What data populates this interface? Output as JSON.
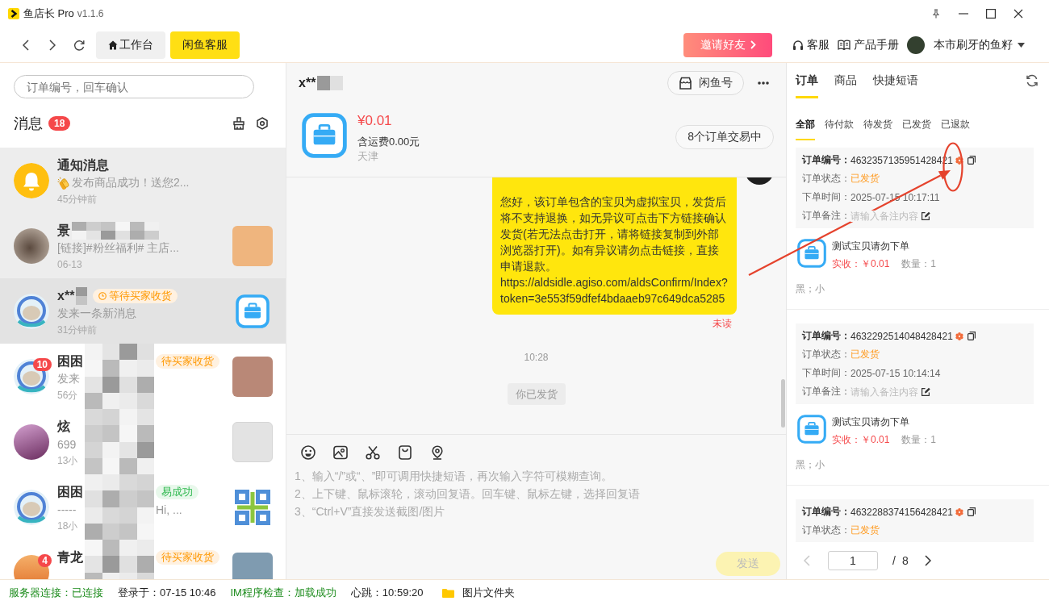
{
  "window": {
    "title": "鱼店长 Pro",
    "version": "v1.1.6"
  },
  "toolbar": {
    "tabs": [
      {
        "label": "工作台",
        "kind": "home",
        "selected": false
      },
      {
        "label": "闲鱼客服",
        "kind": "plain",
        "selected": true
      }
    ],
    "invite_button": "邀请好友",
    "links": [
      {
        "kind": "support",
        "label": "客服"
      },
      {
        "kind": "manual",
        "label": "产品手册"
      }
    ],
    "user_name": "本市刷牙的鱼籽"
  },
  "messages": {
    "search": {
      "placeholder": "订单编号，回车确认"
    },
    "title": "消息",
    "unread_total": "18",
    "conversations": [
      {
        "avatar": {
          "kind": "bell"
        },
        "name": "通知消息",
        "emoji": true,
        "preview": "发布商品成功！送您2...",
        "time": "45分钟前",
        "pinned": true,
        "selected": false
      },
      {
        "avatar": {
          "kind": "photo"
        },
        "name": "景",
        "mosaic": {
          "kind": "name"
        },
        "emoji": false,
        "preview": "[链接]#粉丝福利# 主店...",
        "time": "06-13",
        "thumbnail": {
          "kind": "photo"
        },
        "pinned": true,
        "selected": false
      },
      {
        "avatar": {
          "kind": "cartoon"
        },
        "name": "x**",
        "mosaic": {
          "kind": "name"
        },
        "tag": {
          "text": "等待买家收货",
          "kind": "pending",
          "icon": true
        },
        "emoji": false,
        "preview": "发来一条新消息",
        "time": "31分钟前",
        "thumbnail": {
          "kind": "briefcase"
        },
        "pinned": false,
        "selected": true
      },
      {
        "avatar": {
          "kind": "cartoon"
        },
        "unread": "10",
        "name": "困困",
        "mosaic": {
          "kind": "column"
        },
        "tag": {
          "text": "待买家收货",
          "kind": "pending",
          "icon": false
        },
        "emoji": false,
        "preview": "发来",
        "time": "56分",
        "thumbnail": {
          "kind": "photo"
        },
        "pinned": false,
        "selected": false
      },
      {
        "avatar": {
          "kind": "artwork"
        },
        "name": "炫",
        "mosaic": {
          "kind": "column"
        },
        "emoji": false,
        "preview": "699",
        "time": "13小",
        "thumbnail": {
          "kind": "screenshot"
        },
        "pinned": false,
        "selected": false
      },
      {
        "avatar": {
          "kind": "cartoon"
        },
        "name": "困困",
        "mosaic": {
          "kind": "column"
        },
        "tag": {
          "text": "易成功",
          "kind": "success",
          "icon": false
        },
        "emoji": false,
        "preview": "-----",
        "preview_tail": "Hi, ...",
        "time": "18小",
        "thumbnail": {
          "kind": "pattern"
        },
        "pinned": false,
        "selected": false
      },
      {
        "avatar": {
          "kind": "sunset"
        },
        "unread": "4",
        "name": "青龙",
        "mosaic": {
          "kind": "column"
        },
        "tag": {
          "text": "待买家收货",
          "kind": "pending",
          "icon": false
        },
        "emoji": false,
        "thumbnail": {
          "kind": "photo"
        },
        "pinned": false,
        "selected": false
      }
    ]
  },
  "chat": {
    "header": {
      "name": "x**",
      "redacted": true,
      "account_button": "闲鱼号"
    },
    "product": {
      "price": "¥0.01",
      "shipping": "含运费0.00元",
      "location": "天津",
      "orders_button": "8个订单交易中"
    },
    "messages": [
      {
        "kind": "bubble",
        "text": "您好，该订单包含的宝贝为虚拟宝贝，发货后将不支持退换，如无异议可点击下方链接确认发货(若无法点击打开，请将链接复制到外部浏览器打开)。如有异议请勿点击链接，直接申请退款。\nhttps://aldsidle.agiso.com/aldsConfirm/Index?token=3e553f59dfef4bdaaeb97c649dca5285",
        "status": "未读"
      },
      {
        "kind": "time",
        "text": "10:28"
      },
      {
        "kind": "system",
        "text": "你已发货"
      }
    ],
    "composer": {
      "placeholder": "1、输入“/”或“、”即可调用快捷短语，再次输入字符可模糊查询。\n2、上下键、鼠标滚轮，滚动回复语。回车键、鼠标左键，选择回复语\n3、“Ctrl+V”直接发送截图/图片",
      "send_button": "发送",
      "send_disabled": true
    }
  },
  "orders": {
    "tabs": [
      {
        "label": "订单",
        "selected": true
      },
      {
        "label": "商品",
        "selected": false
      },
      {
        "label": "快捷短语",
        "selected": false
      }
    ],
    "filters": [
      {
        "label": "全部",
        "selected": true
      },
      {
        "label": "待付款",
        "selected": false
      },
      {
        "label": "待发货",
        "selected": false
      },
      {
        "label": "已发货",
        "selected": false
      },
      {
        "label": "已退款",
        "selected": false
      }
    ],
    "list": [
      {
        "fields": [
          {
            "kind": "number",
            "label": "订单编号：",
            "value": "4632357135951428421"
          },
          {
            "kind": "status",
            "label": "订单状态：",
            "value": "已发货"
          },
          {
            "kind": "time",
            "label": "下单时间：",
            "value": "2025-07-15 10:17:11"
          },
          {
            "kind": "note",
            "label": "订单备注：",
            "placeholder": "请输入备注内容"
          }
        ],
        "item": {
          "title": "测试宝贝请勿下单",
          "paid": "实收：￥0.01",
          "quantity": "数量：1",
          "spec": "黑；小"
        }
      },
      {
        "fields": [
          {
            "kind": "number",
            "label": "订单编号：",
            "value": "4632292514048428421"
          },
          {
            "kind": "status",
            "label": "订单状态：",
            "value": "已发货"
          },
          {
            "kind": "time",
            "label": "下单时间：",
            "value": "2025-07-15 10:14:14"
          },
          {
            "kind": "note",
            "label": "订单备注：",
            "placeholder": "请输入备注内容"
          }
        ],
        "item": {
          "title": "测试宝贝请勿下单",
          "paid": "实收：￥0.01",
          "quantity": "数量：1",
          "spec": "黑；小"
        }
      },
      {
        "fields": [
          {
            "kind": "number",
            "label": "订单编号：",
            "value": "4632288374156428421"
          },
          {
            "kind": "status",
            "label": "订单状态：",
            "value": "已发货"
          }
        ]
      }
    ],
    "pagination": {
      "prev_disabled": true,
      "page": "1",
      "separator": "/",
      "total": "8"
    }
  },
  "status_bar": {
    "items": [
      {
        "text": "服务器连接：已连接",
        "kind": "ok"
      },
      {
        "text": "登录于：07-15 10:46",
        "kind": "plain"
      },
      {
        "text": "IM程序检查：加载成功",
        "kind": "ok"
      },
      {
        "text": "心跳：10:59:20",
        "kind": "plain"
      }
    ],
    "folder_link": "图片文件夹"
  }
}
